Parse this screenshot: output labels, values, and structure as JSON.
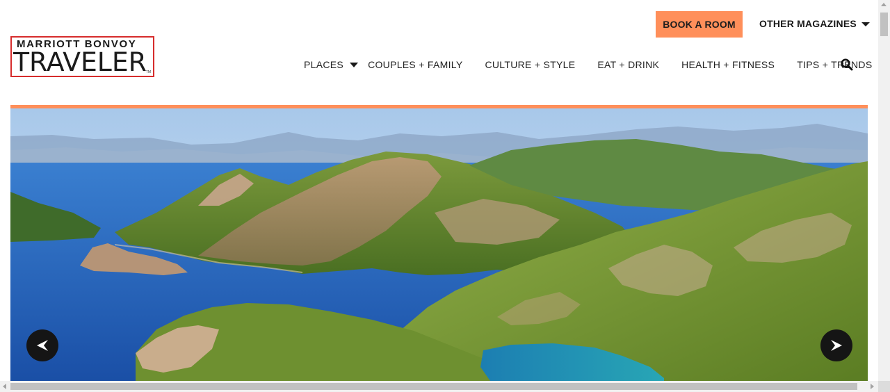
{
  "brand": {
    "line1": "MARRIOTT BONVᴼY",
    "line1_display": "MARRIOTT BONVOY",
    "title": "TRAVELER",
    "tm": "TM"
  },
  "header": {
    "book_label": "BOOK A ROOM",
    "other_magazines_label": "OTHER MAGAZINES"
  },
  "nav": {
    "items": [
      {
        "label": "PLACES",
        "has_dropdown": true
      },
      {
        "label": "COUPLES + FAMILY",
        "has_dropdown": false
      },
      {
        "label": "CULTURE + STYLE",
        "has_dropdown": false
      },
      {
        "label": "EAT + DRINK",
        "has_dropdown": false
      },
      {
        "label": "HEALTH + FITNESS",
        "has_dropdown": false
      },
      {
        "label": "TIPS + TRENDS",
        "has_dropdown": false
      }
    ],
    "search_icon": "search-icon"
  },
  "hero": {
    "image": "coastal-mountains-lagoon-photo",
    "prev_icon": "chevron-left-icon",
    "next_icon": "chevron-right-icon"
  },
  "colors": {
    "accent": "#ff8f5a",
    "text": "#1a1a1a",
    "logo_border": "#d62c2c",
    "arrow_bg": "#151515"
  }
}
